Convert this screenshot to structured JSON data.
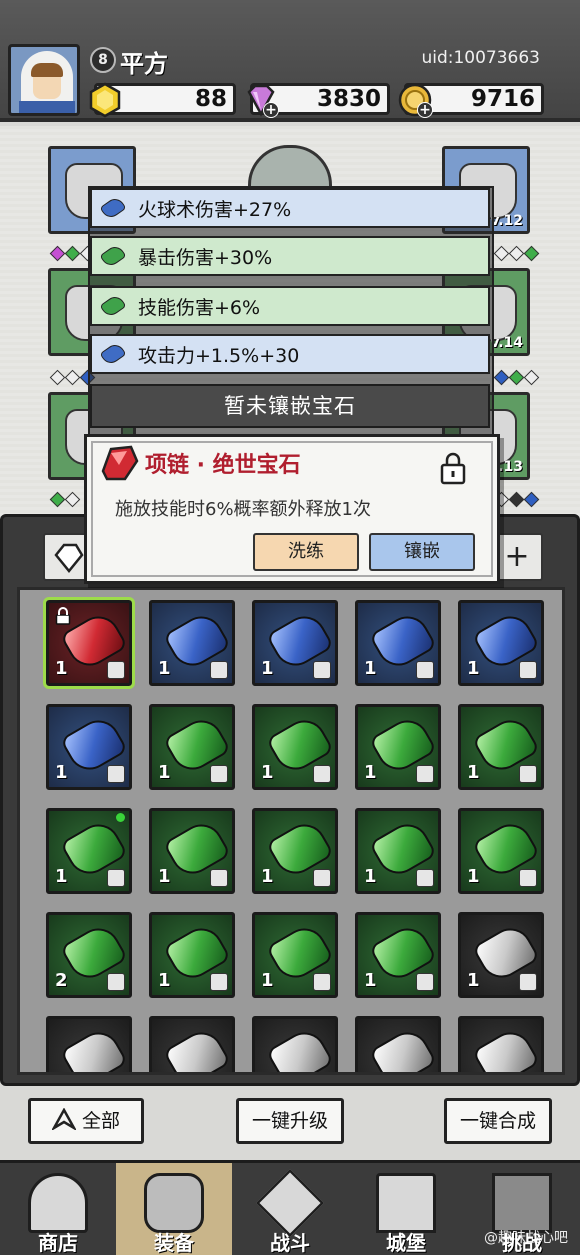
{
  "player": {
    "level": "8",
    "name": "平方",
    "uid": "uid:10073663"
  },
  "currencies": {
    "gold_gem": "88",
    "diamond": "3830",
    "coin": "9716"
  },
  "equip_slots": {
    "left_top_level": "",
    "right_top_level": "v.12",
    "right_mid_level": "v.14",
    "right_bottom_level": ".13"
  },
  "stats": [
    {
      "label": "火球术伤害+27%",
      "color": "blue"
    },
    {
      "label": "暴击伤害+30%",
      "color": "green"
    },
    {
      "label": "技能伤害+6%",
      "color": "green"
    },
    {
      "label": "攻击力+1.5%+30",
      "color": "blue"
    }
  ],
  "empty_socket_label": "暂未镶嵌宝石",
  "popup": {
    "title": "项链 · 绝世宝石",
    "description": "施放技能时6%概率额外释放1次",
    "refine_label": "洗练",
    "inlay_label": "镶嵌"
  },
  "inventory": {
    "filter_add": "+",
    "gems": [
      {
        "color": "red",
        "count": "1",
        "locked": true
      },
      {
        "color": "blue",
        "count": "1"
      },
      {
        "color": "blue",
        "count": "1"
      },
      {
        "color": "blue",
        "count": "1"
      },
      {
        "color": "blue",
        "count": "1"
      },
      {
        "color": "blue",
        "count": "1"
      },
      {
        "color": "green",
        "count": "1"
      },
      {
        "color": "green",
        "count": "1"
      },
      {
        "color": "green",
        "count": "1"
      },
      {
        "color": "green",
        "count": "1"
      },
      {
        "color": "green",
        "count": "1",
        "new": true
      },
      {
        "color": "green",
        "count": "1"
      },
      {
        "color": "green",
        "count": "1"
      },
      {
        "color": "green",
        "count": "1"
      },
      {
        "color": "green",
        "count": "1"
      },
      {
        "color": "green",
        "count": "2"
      },
      {
        "color": "green",
        "count": "1"
      },
      {
        "color": "green",
        "count": "1"
      },
      {
        "color": "green",
        "count": "1"
      },
      {
        "color": "white",
        "count": "1"
      },
      {
        "color": "white",
        "count": ""
      },
      {
        "color": "white",
        "count": ""
      },
      {
        "color": "white",
        "count": ""
      },
      {
        "color": "white",
        "count": ""
      },
      {
        "color": "white",
        "count": ""
      }
    ]
  },
  "actions": {
    "all_label": "全部",
    "upgrade_all_label": "一键升级",
    "merge_all_label": "一键合成"
  },
  "nav": [
    {
      "label": "商店"
    },
    {
      "label": "装备"
    },
    {
      "label": "战斗"
    },
    {
      "label": "城堡"
    },
    {
      "label": "挑战"
    }
  ],
  "watermark": "@趣味战心吧"
}
